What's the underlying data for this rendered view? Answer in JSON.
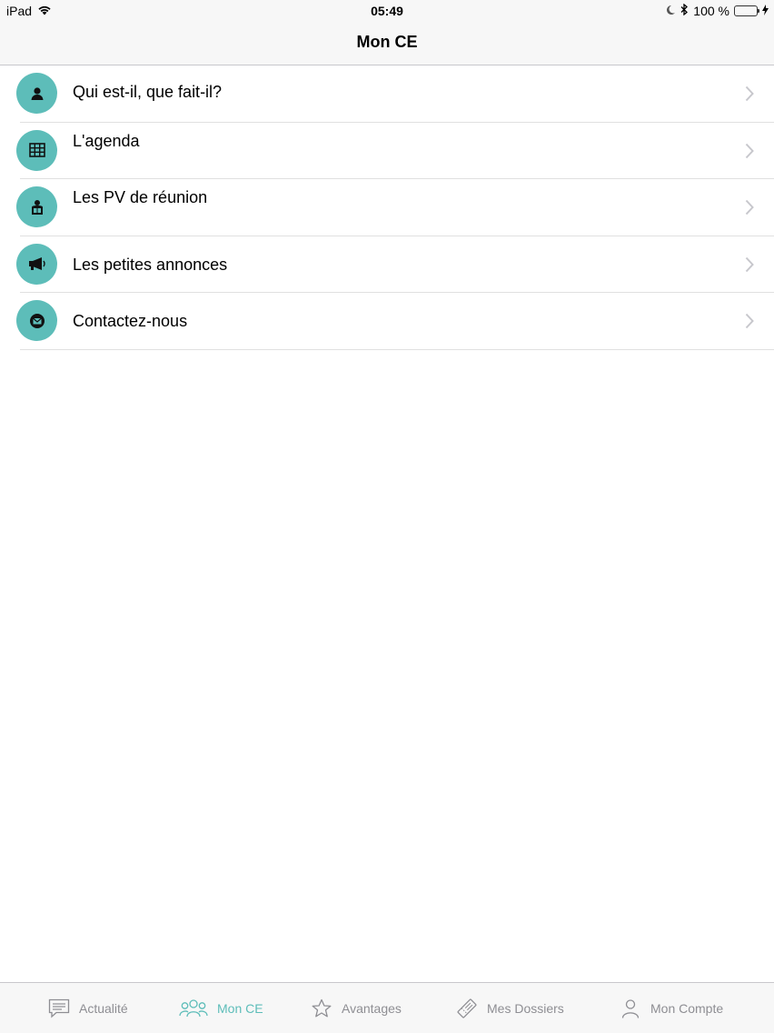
{
  "status_bar": {
    "device": "iPad",
    "time": "05:49",
    "battery": "100 %"
  },
  "nav": {
    "title": "Mon CE"
  },
  "list": [
    {
      "label": "Qui est-il, que fait-il?",
      "icon": "person-icon"
    },
    {
      "label": "L'agenda",
      "icon": "calendar-grid-icon"
    },
    {
      "label": "Les PV de réunion",
      "icon": "reading-person-icon"
    },
    {
      "label": "Les petites annonces",
      "icon": "megaphone-icon"
    },
    {
      "label": "Contactez-nous",
      "icon": "envelope-icon"
    }
  ],
  "tabs": [
    {
      "label": "Actualité",
      "icon": "message-icon",
      "active": false
    },
    {
      "label": "Mon CE",
      "icon": "group-icon",
      "active": true
    },
    {
      "label": "Avantages",
      "icon": "star-icon",
      "active": false
    },
    {
      "label": "Mes Dossiers",
      "icon": "ticket-icon",
      "active": false
    },
    {
      "label": "Mon Compte",
      "icon": "user-icon",
      "active": false
    }
  ],
  "colors": {
    "accent": "#5dbdb9",
    "inactive_tab": "#8e8e93",
    "bar_background": "#f7f7f7",
    "battery": "#4cd964"
  }
}
